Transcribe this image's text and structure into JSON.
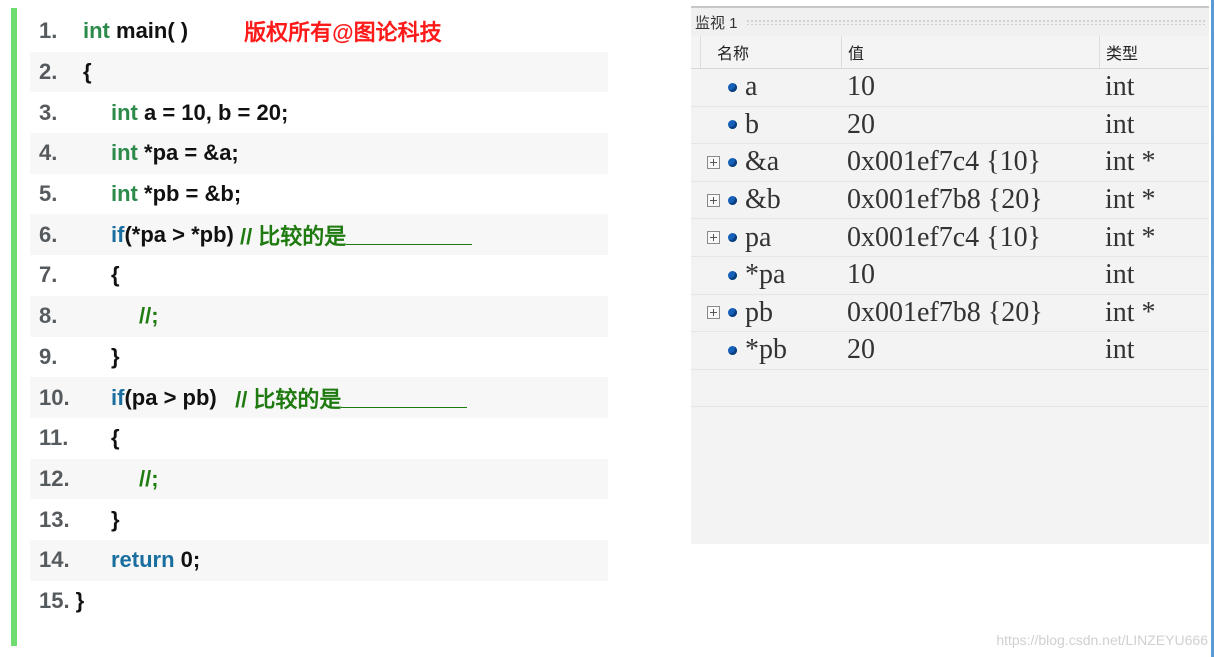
{
  "code": {
    "watermark_title": "版权所有@图论科技",
    "lines": [
      {
        "num": "1.",
        "parts": [
          {
            "t": "int",
            "c": "kw"
          },
          {
            "t": " main( )",
            "c": ""
          }
        ]
      },
      {
        "num": "2.",
        "parts": [
          {
            "t": "{",
            "c": ""
          }
        ]
      },
      {
        "num": "3.",
        "parts": [
          {
            "t": "int",
            "c": "kw"
          },
          {
            "t": " a = 10, b = 20;",
            "c": ""
          }
        ]
      },
      {
        "num": "4.",
        "parts": [
          {
            "t": "int",
            "c": "kw"
          },
          {
            "t": " *pa = &a;",
            "c": ""
          }
        ]
      },
      {
        "num": "5.",
        "parts": [
          {
            "t": "int",
            "c": "kw"
          },
          {
            "t": " *pb = &b;",
            "c": ""
          }
        ]
      },
      {
        "num": "6.",
        "parts": [
          {
            "t": "if",
            "c": "if"
          },
          {
            "t": "(*pa > *pb) ",
            "c": ""
          },
          {
            "t": "// 比较的是",
            "c": "cm"
          }
        ]
      },
      {
        "num": "7.",
        "parts": [
          {
            "t": "{",
            "c": ""
          }
        ]
      },
      {
        "num": "8.",
        "parts": [
          {
            "t": "//;",
            "c": "cm"
          }
        ]
      },
      {
        "num": "9.",
        "parts": [
          {
            "t": "}",
            "c": ""
          }
        ]
      },
      {
        "num": "10.",
        "parts": [
          {
            "t": "if",
            "c": "if"
          },
          {
            "t": "(pa > pb)   ",
            "c": ""
          },
          {
            "t": "// 比较的是",
            "c": "cm"
          }
        ]
      },
      {
        "num": "11.",
        "parts": [
          {
            "t": "{",
            "c": ""
          }
        ]
      },
      {
        "num": "12.",
        "parts": [
          {
            "t": "//;",
            "c": "cm"
          }
        ]
      },
      {
        "num": "13.",
        "parts": [
          {
            "t": "}",
            "c": ""
          }
        ]
      },
      {
        "num": "14.",
        "parts": [
          {
            "t": "return",
            "c": "ret"
          },
          {
            "t": " 0;",
            "c": ""
          }
        ]
      },
      {
        "num": "15.",
        "parts": [
          {
            "t": "}",
            "c": ""
          }
        ]
      }
    ]
  },
  "watch": {
    "title": "监视 1",
    "columns": {
      "name": "名称",
      "value": "值",
      "type": "类型"
    },
    "rows": [
      {
        "expandable": false,
        "name": "a",
        "value": "10",
        "type": "int"
      },
      {
        "expandable": false,
        "name": "b",
        "value": "20",
        "type": "int"
      },
      {
        "expandable": true,
        "name": "&a",
        "value": "0x001ef7c4 {10}",
        "type": "int *"
      },
      {
        "expandable": true,
        "name": "&b",
        "value": "0x001ef7b8 {20}",
        "type": "int *"
      },
      {
        "expandable": true,
        "name": "pa",
        "value": "0x001ef7c4 {10}",
        "type": "int *"
      },
      {
        "expandable": false,
        "name": "*pa",
        "value": "10",
        "type": "int"
      },
      {
        "expandable": true,
        "name": "pb",
        "value": "0x001ef7b8 {20}",
        "type": "int *"
      },
      {
        "expandable": false,
        "name": "*pb",
        "value": "20",
        "type": "int"
      }
    ]
  },
  "watermark": "https://blog.csdn.net/LINZEYU666",
  "colors": {
    "keyword": "#2c8a4a",
    "control": "#1a6fa0",
    "comment": "#1f7a10",
    "copyright": "#ff1a1a",
    "accent_bar": "#6fdc6f"
  }
}
